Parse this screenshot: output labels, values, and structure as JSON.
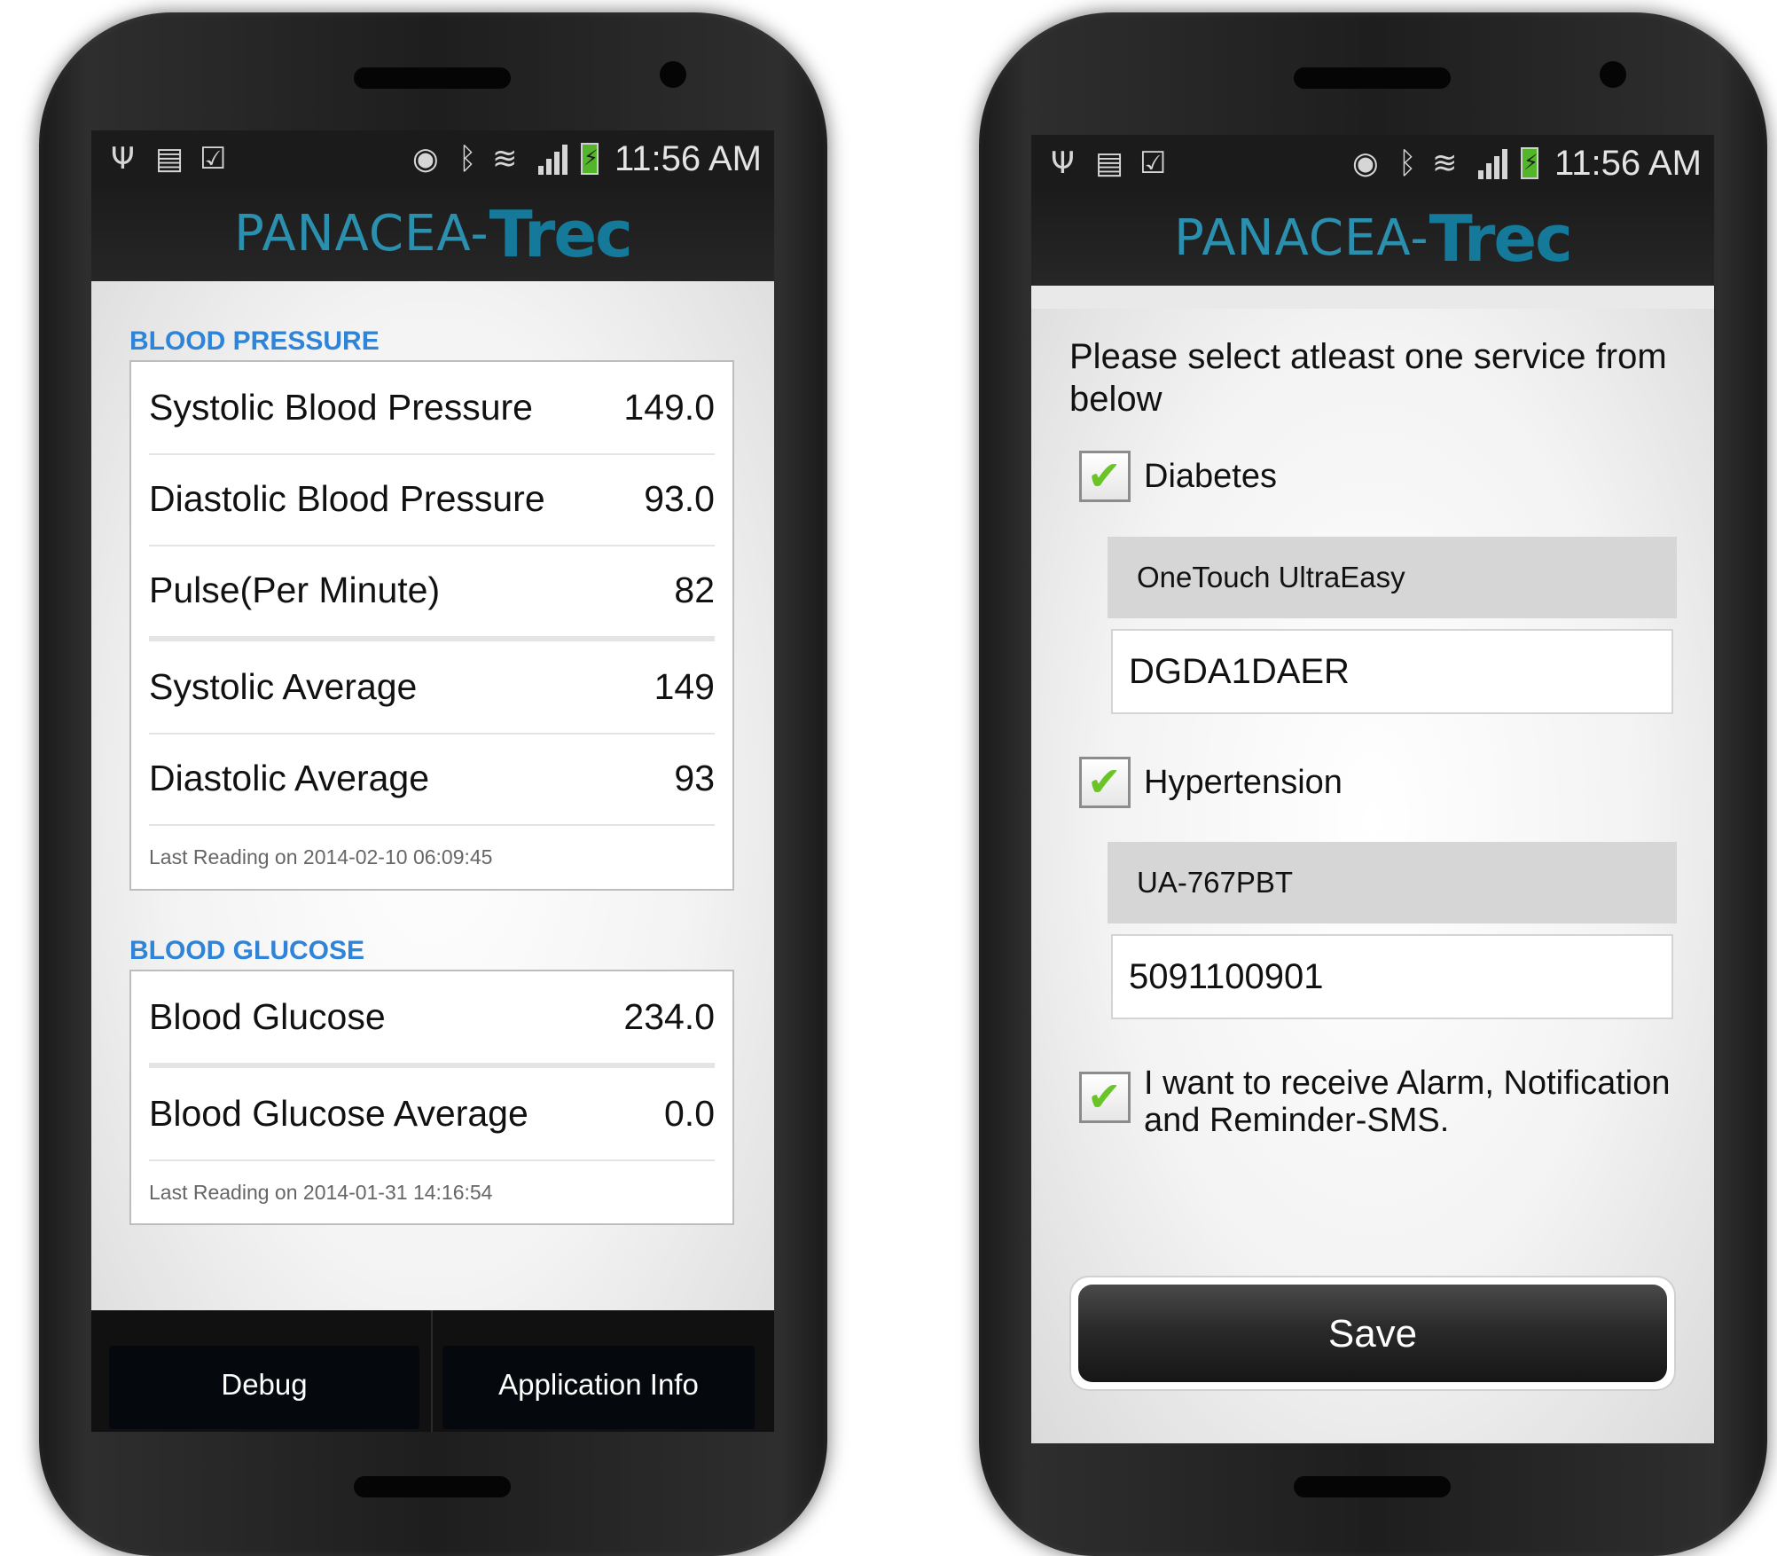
{
  "status_bar": {
    "time": "11:56 AM",
    "icons": [
      "usb-icon",
      "sim-icon",
      "shopping-bag-icon",
      "eye-icon",
      "bluetooth-icon",
      "wifi-icon",
      "signal-icon",
      "battery-charging-icon"
    ]
  },
  "brand": {
    "logo_part1": "PANACEA-",
    "logo_part2": "Trec",
    "logo_color": "#2b8fae"
  },
  "dashboard": {
    "blood_pressure": {
      "title": "BLOOD PRESSURE",
      "rows": [
        {
          "label": "Systolic Blood Pressure",
          "value": "149.0"
        },
        {
          "label": "Diastolic Blood Pressure",
          "value": "93.0"
        },
        {
          "label": "Pulse(Per Minute)",
          "value": "82"
        },
        {
          "label": "Systolic Average",
          "value": "149"
        },
        {
          "label": "Diastolic Average",
          "value": "93"
        }
      ],
      "last_reading": "Last Reading on 2014-02-10 06:09:45"
    },
    "blood_glucose": {
      "title": "BLOOD GLUCOSE",
      "rows": [
        {
          "label": "Blood Glucose",
          "value": "234.0"
        },
        {
          "label": "Blood Glucose Average",
          "value": "0.0"
        }
      ],
      "last_reading": "Last Reading on 2014-01-31 14:16:54"
    },
    "footer": {
      "debug_label": "Debug",
      "app_info_label": "Application Info"
    },
    "accent_color": "#2e84d8"
  },
  "services": {
    "prompt": "Please select atleast one service from below",
    "diabetes": {
      "label": "Diabetes",
      "checked": true,
      "device": "OneTouch UltraEasy",
      "serial": "DGDA1DAER"
    },
    "hypertension": {
      "label": "Hypertension",
      "checked": true,
      "device": "UA-767PBT",
      "serial": "5091100901"
    },
    "sms_opt_in": {
      "label": "I want to receive Alarm, Notification and Reminder-SMS.",
      "checked": true
    },
    "save_label": "Save",
    "check_color": "#6ac428"
  }
}
